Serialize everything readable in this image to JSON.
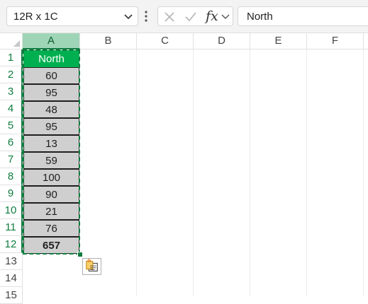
{
  "name_box": {
    "value": "12R x 1C"
  },
  "formula_bar": {
    "fx_label": "fx",
    "content": "North"
  },
  "columns": [
    "A",
    "B",
    "C",
    "D",
    "E",
    "F"
  ],
  "rows": [
    "1",
    "2",
    "3",
    "4",
    "5",
    "6",
    "7",
    "8",
    "9",
    "10",
    "11",
    "12",
    "13",
    "14",
    "15"
  ],
  "column_a": {
    "header": "North",
    "values": [
      "60",
      "95",
      "48",
      "95",
      "13",
      "59",
      "100",
      "90",
      "21",
      "76"
    ],
    "total": "657"
  },
  "colors": {
    "header_fill": "#00b050",
    "selected_fill": "#cfcfcf",
    "accent": "#107c41"
  },
  "icons": {
    "paste_options": "paste-options-icon"
  }
}
